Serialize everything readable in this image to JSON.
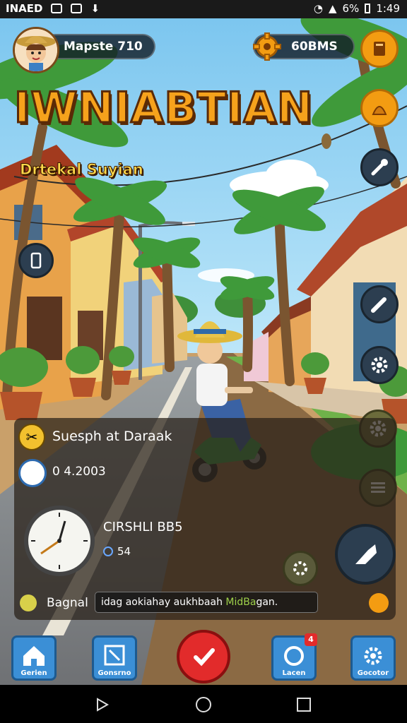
{
  "status_bar": {
    "carrier": "INAED",
    "battery": "6%",
    "time": "1:49"
  },
  "player": {
    "name": "Mapste 710",
    "coins": "60BMS"
  },
  "game": {
    "title": "IWNIABTIAN",
    "subtitle": "Drtekal Suyian"
  },
  "panel": {
    "quest": "Suesph at Daraak",
    "quest_value": "0 4.2003",
    "timer_label": "CIRSHLI BB5",
    "timer_value": "54",
    "footer_label": "Bagnal",
    "footer_text_pre": "idag aokiahay aukhbaah ",
    "footer_text_highlight": "MidBa",
    "footer_text_post": "gan."
  },
  "nav": {
    "home": "Gerien",
    "map": "Gonsrno",
    "ring": "Lacen",
    "settings": "Gocotor",
    "ring_badge": "4"
  },
  "colors": {
    "accent": "#f39c12",
    "nav": "#3b8fd6"
  }
}
